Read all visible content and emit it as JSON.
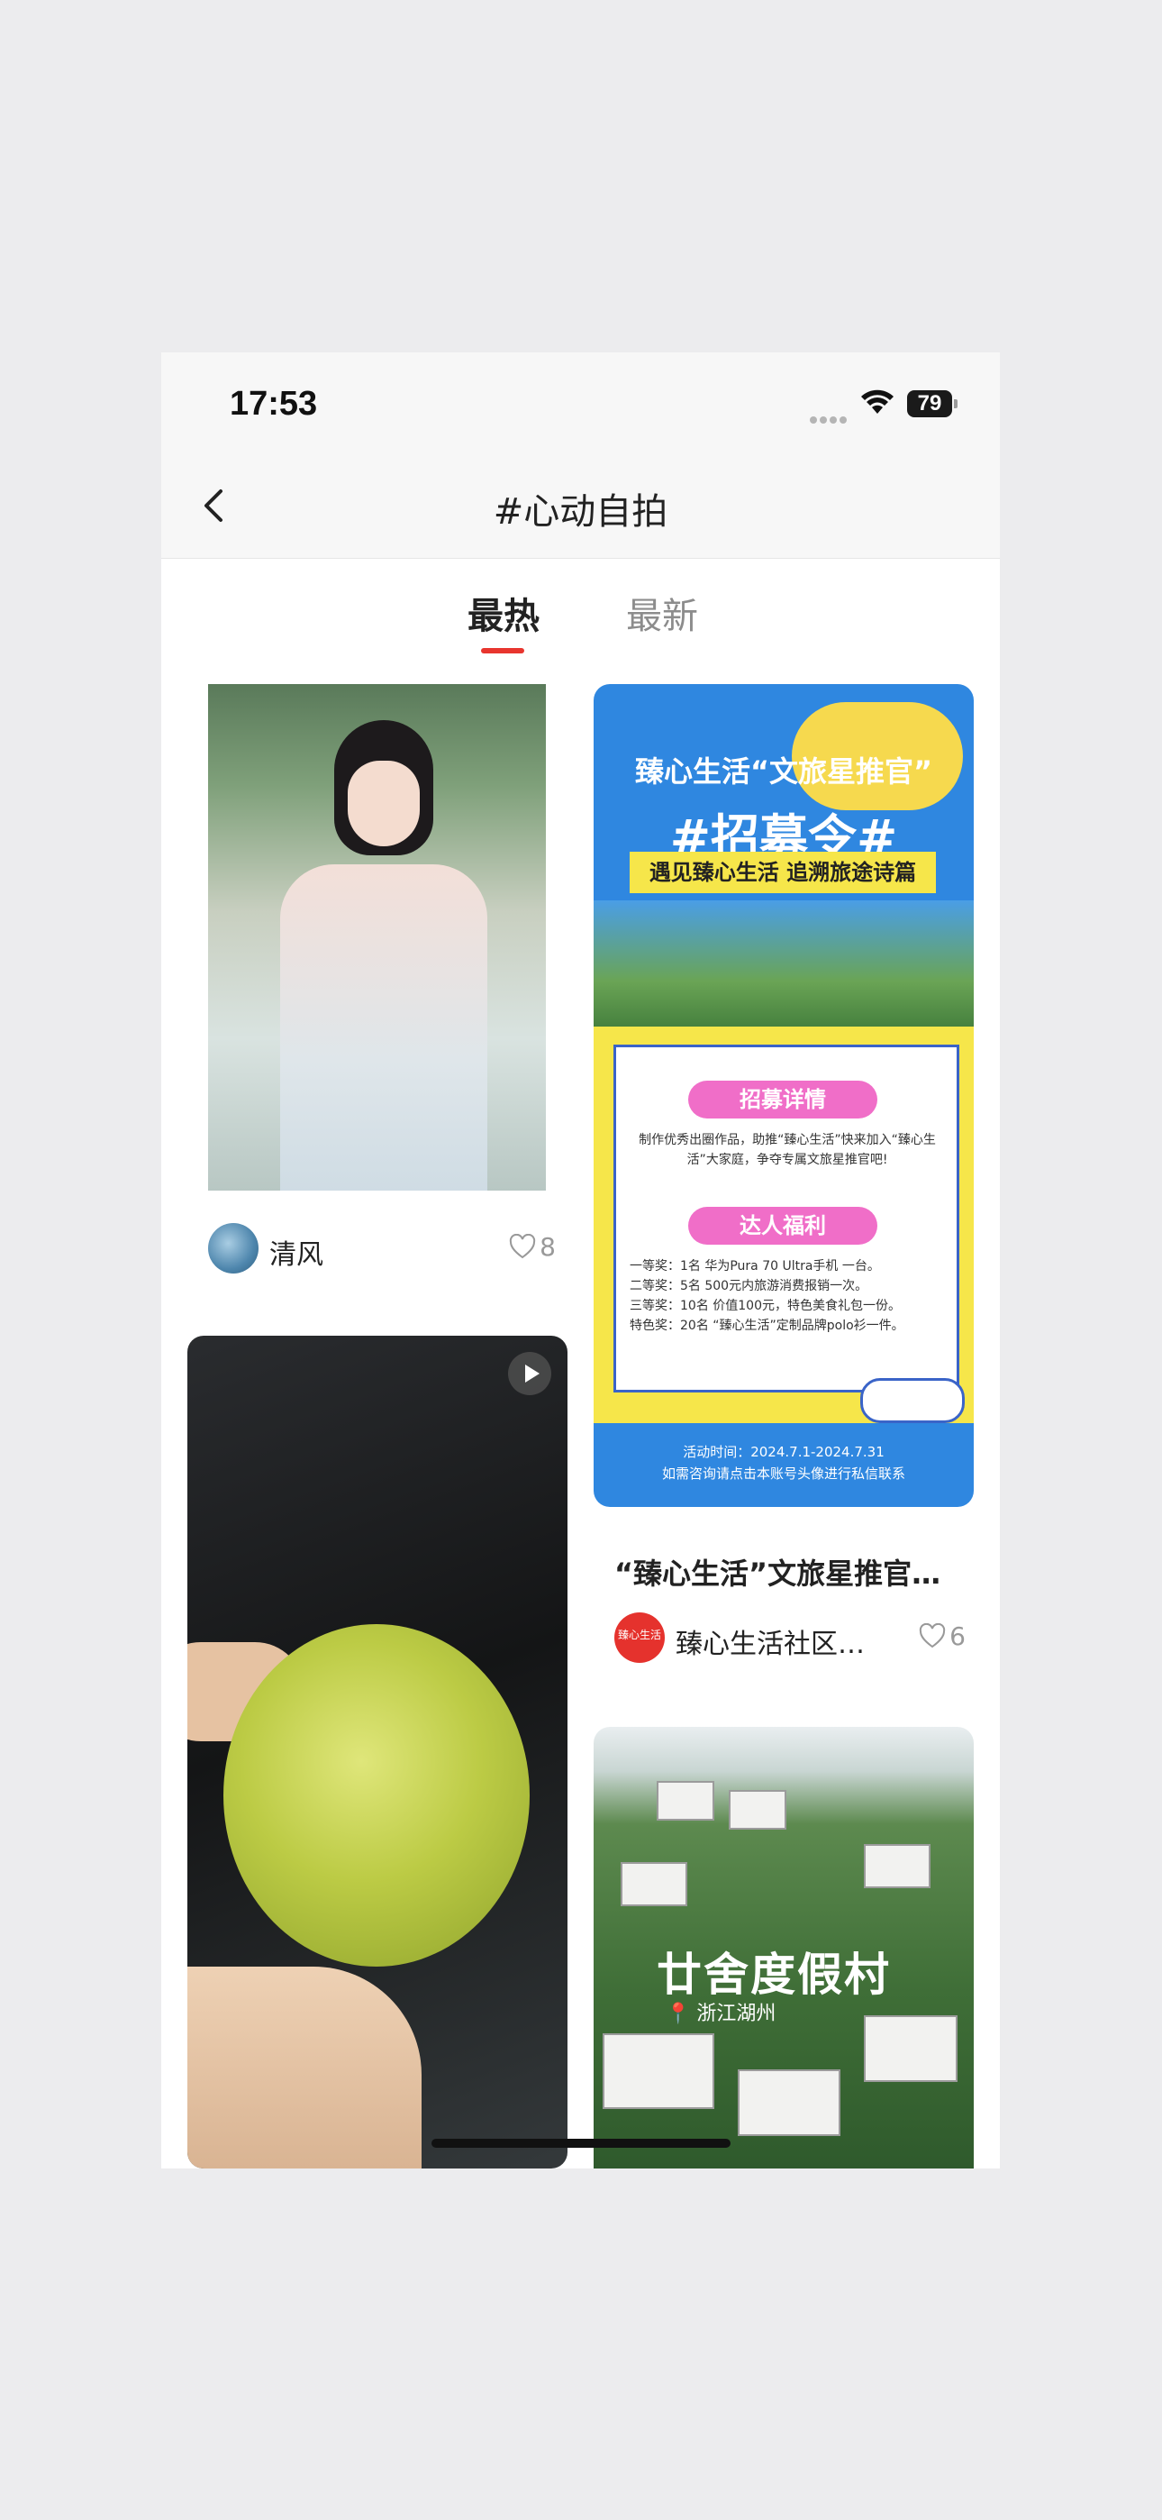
{
  "status_bar": {
    "time": "17:53",
    "battery": "79"
  },
  "nav": {
    "title": "#心动自拍"
  },
  "tabs": [
    {
      "label": "最热",
      "active": true
    },
    {
      "label": "最新",
      "active": false
    }
  ],
  "posts": [
    {
      "author": "清风",
      "likes": "8"
    },
    {
      "type": "video"
    },
    {
      "title": "“臻心生活”文旅星推官…",
      "author": "臻心生活社区…",
      "likes": "6",
      "poster": {
        "headline": "臻心生活“文旅星推官”",
        "big": "#招募令#",
        "band": "遇见臻心生活 追溯旅途诗篇",
        "section1": "招募详情",
        "section1_text": "制作优秀出圈作品，助推“臻心生活”快来加入“臻心生活”大家庭，争夺专属文旅星推官吧!",
        "section2": "达人福利",
        "prizes": [
          "一等奖：1名   华为Pura 70 Ultra手机 一台。",
          "二等奖：5名   500元内旅游消费报销一次。",
          "三等奖：10名  价值100元，特色美食礼包一份。",
          "特色奖：20名  “臻心生活”定制品牌polo衫一件。"
        ],
        "footer1": "活动时间：2024.7.1-2024.7.31",
        "footer2": "如需咨询请点击本账号头像进行私信联系"
      },
      "avatar_text": "臻心生活"
    },
    {
      "resort_title": "廿舍度假村",
      "resort_location": "浙江湖州"
    }
  ],
  "colors": {
    "accent": "#e8352e",
    "poster_blue": "#2f87e0",
    "poster_yellow": "#f6e64a",
    "poster_pink": "#f06ec8"
  }
}
